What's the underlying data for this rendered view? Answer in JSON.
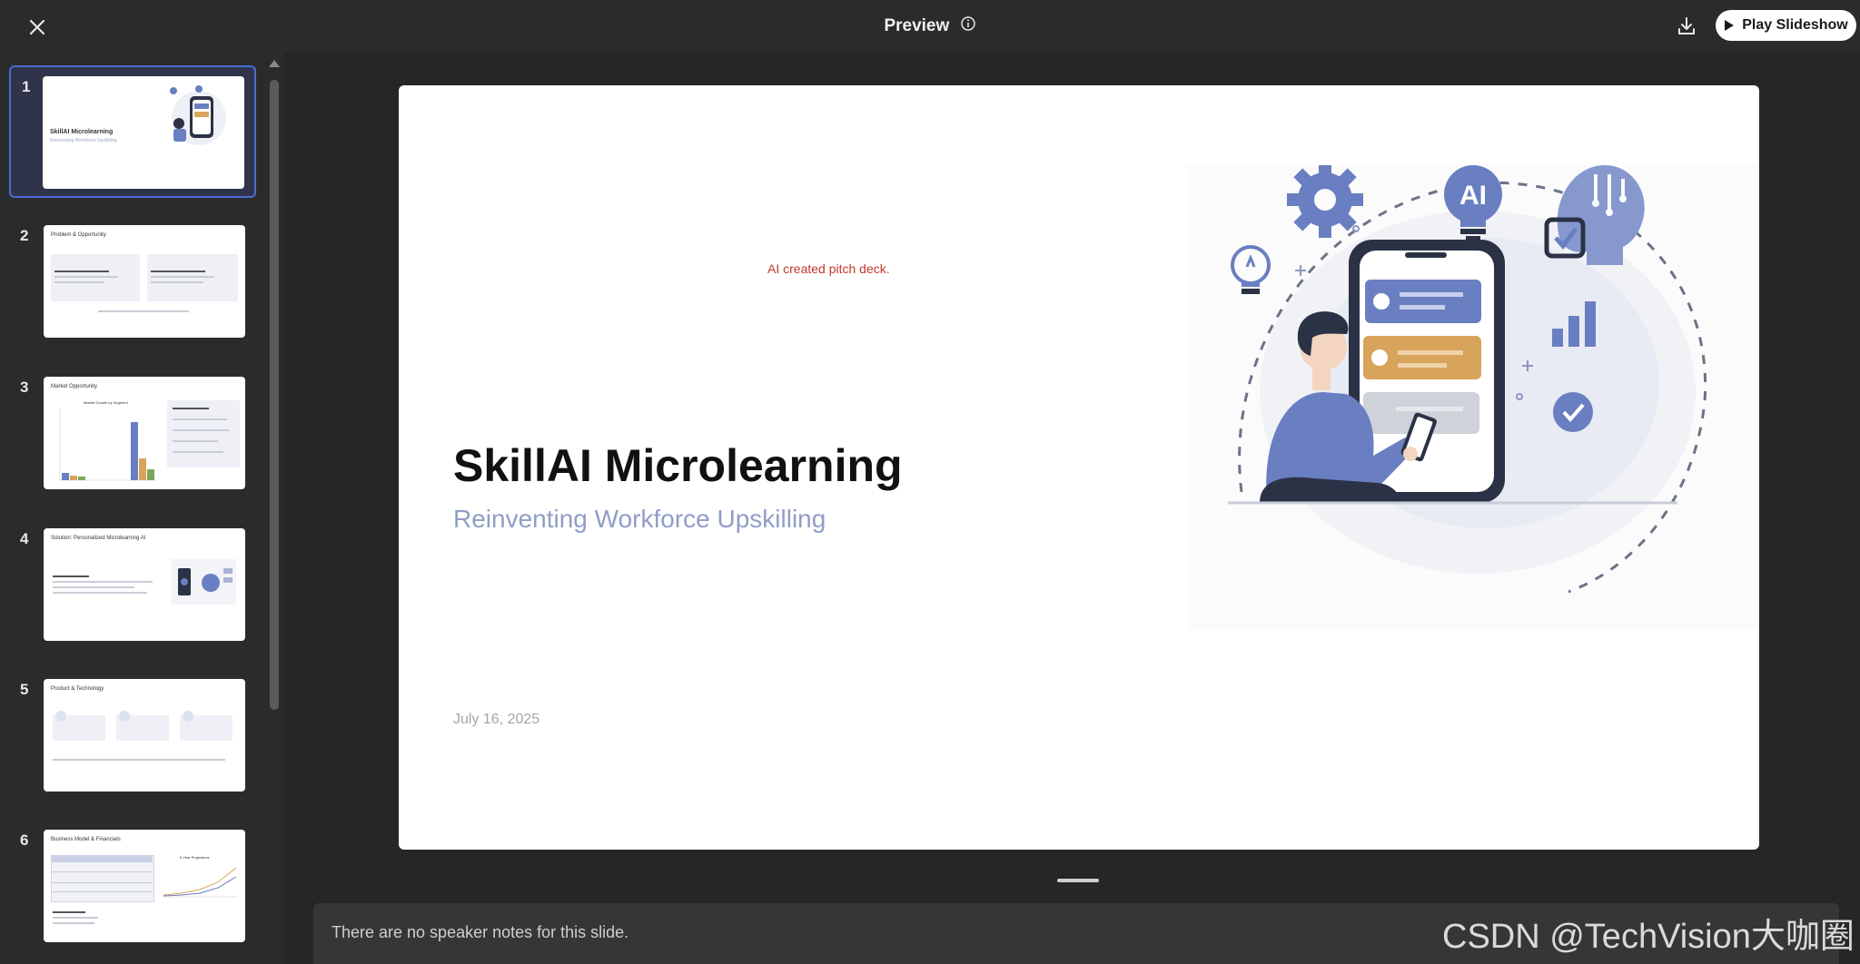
{
  "header": {
    "title": "Preview",
    "play_label": "Play Slideshow"
  },
  "icons": {
    "close": "close-icon",
    "info": "info-icon",
    "download": "download-icon",
    "play": "play-icon"
  },
  "colors": {
    "background": "#292929",
    "selection": "#4a6cd4",
    "accent_blue": "#6a7fc1",
    "accent_orange": "#d8a35a",
    "ai_note": "#c0392b"
  },
  "thumbnails": [
    {
      "number": "1",
      "title": "SkillAI Microlearning",
      "subtitle": "Reinventing Workforce Upskilling"
    },
    {
      "number": "2",
      "title": "Problem & Opportunity"
    },
    {
      "number": "3",
      "title": "Market Opportunity",
      "chart_title": "Market Growth by Segment"
    },
    {
      "number": "4",
      "title": "Solution: Personalized Microlearning AI"
    },
    {
      "number": "5",
      "title": "Product & Technology"
    },
    {
      "number": "6",
      "title": "Business Model & Financials",
      "chart_title": "5-Year Projections"
    }
  ],
  "slide": {
    "ai_note": "AI created pitch deck.",
    "title": "SkillAI Microlearning",
    "subtitle": "Reinventing Workforce Upskilling",
    "date": "July 16, 2025",
    "illustration_badge": "AI"
  },
  "notes": {
    "text": "There are no speaker notes for this slide."
  },
  "watermark": "CSDN @TechVision大咖圈"
}
